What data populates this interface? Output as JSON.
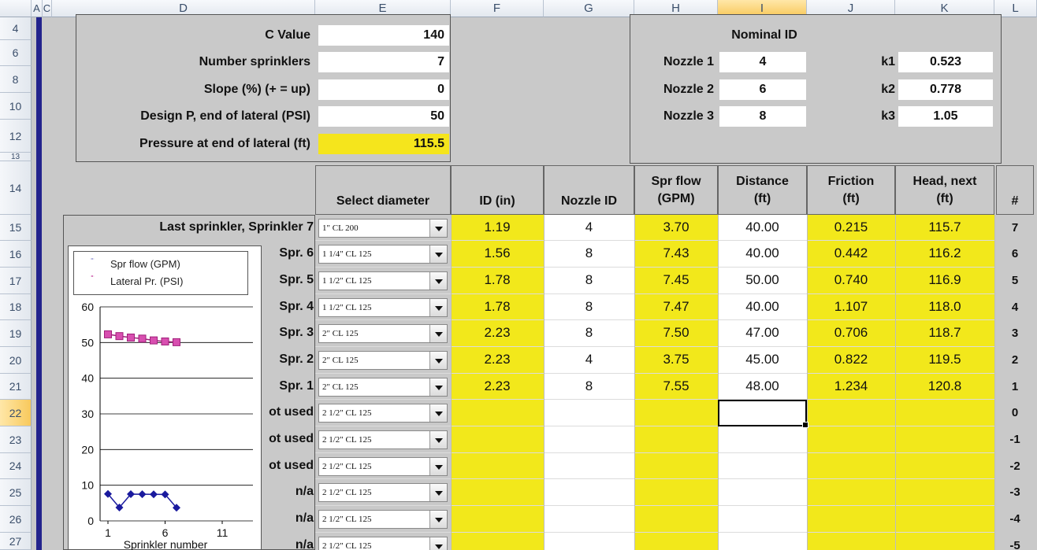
{
  "columns": [
    "A",
    "C",
    "D",
    "E",
    "F",
    "G",
    "H",
    "I",
    "J",
    "K",
    "L"
  ],
  "rows": [
    "4",
    "6",
    "8",
    "10",
    "12",
    "13",
    "14",
    "15",
    "16",
    "17",
    "18",
    "19",
    "20",
    "21",
    "22",
    "23",
    "24",
    "25",
    "26",
    "27"
  ],
  "inputs": {
    "c_value": {
      "label": "C Value",
      "value": "140"
    },
    "num_sprinklers": {
      "label": "Number sprinklers",
      "value": "7"
    },
    "slope": {
      "label": "Slope (%) (+ = up)",
      "value": "0"
    },
    "design_p": {
      "label": "Design P, end of lateral (PSI)",
      "value": "50"
    },
    "pressure_end": {
      "label": "Pressure at end of lateral (ft)",
      "value": "115.5"
    }
  },
  "nozzles": {
    "header": "Nominal ID",
    "items": [
      {
        "label": "Nozzle 1",
        "id": "4",
        "klabel": "k1",
        "k": "0.523"
      },
      {
        "label": "Nozzle 2",
        "id": "6",
        "klabel": "k2",
        "k": "0.778"
      },
      {
        "label": "Nozzle 3",
        "id": "8",
        "klabel": "k3",
        "k": "1.05"
      }
    ]
  },
  "table": {
    "headers": {
      "select": "Select diameter",
      "id": "ID (in)",
      "nozzle": "Nozzle ID",
      "spr1": "Spr flow",
      "spr2": "(GPM)",
      "dist1": "Distance",
      "dist2": "(ft)",
      "fric1": "Friction",
      "fric2": "(ft)",
      "head1": "Head, next",
      "head2": "(ft)",
      "num": "#"
    },
    "last_label": "Last sprinkler, Sprinkler 7",
    "rows": [
      {
        "label": "",
        "pipe": "1\" CL 200",
        "id": "1.19",
        "nozzle": "4",
        "flow": "3.70",
        "dist": "40.00",
        "fric": "0.215",
        "head": "115.7",
        "num": "7"
      },
      {
        "label": "Spr. 6",
        "pipe": "1 1/4\" CL 125",
        "id": "1.56",
        "nozzle": "8",
        "flow": "7.43",
        "dist": "40.00",
        "fric": "0.442",
        "head": "116.2",
        "num": "6"
      },
      {
        "label": "Spr. 5",
        "pipe": "1 1/2\" CL 125",
        "id": "1.78",
        "nozzle": "8",
        "flow": "7.45",
        "dist": "50.00",
        "fric": "0.740",
        "head": "116.9",
        "num": "5"
      },
      {
        "label": "Spr. 4",
        "pipe": "1 1/2\" CL 125",
        "id": "1.78",
        "nozzle": "8",
        "flow": "7.47",
        "dist": "40.00",
        "fric": "1.107",
        "head": "118.0",
        "num": "4"
      },
      {
        "label": "Spr. 3",
        "pipe": "2\" CL 125",
        "id": "2.23",
        "nozzle": "8",
        "flow": "7.50",
        "dist": "47.00",
        "fric": "0.706",
        "head": "118.7",
        "num": "3"
      },
      {
        "label": "Spr. 2",
        "pipe": "2\" CL 125",
        "id": "2.23",
        "nozzle": "4",
        "flow": "3.75",
        "dist": "45.00",
        "fric": "0.822",
        "head": "119.5",
        "num": "2"
      },
      {
        "label": "Spr. 1",
        "pipe": "2\" CL 125",
        "id": "2.23",
        "nozzle": "8",
        "flow": "7.55",
        "dist": "48.00",
        "fric": "1.234",
        "head": "120.8",
        "num": "1"
      },
      {
        "label": "ot used",
        "pipe": "2 1/2\" CL 125",
        "id": "",
        "nozzle": "",
        "flow": "",
        "dist": "",
        "fric": "",
        "head": "",
        "num": "0"
      },
      {
        "label": "ot used",
        "pipe": "2 1/2\" CL 125",
        "id": "",
        "nozzle": "",
        "flow": "",
        "dist": "",
        "fric": "",
        "head": "",
        "num": "-1"
      },
      {
        "label": "ot used",
        "pipe": "2 1/2\" CL 125",
        "id": "",
        "nozzle": "",
        "flow": "",
        "dist": "",
        "fric": "",
        "head": "",
        "num": "-2"
      },
      {
        "label": "n/a",
        "pipe": "2 1/2\" CL 125",
        "id": "",
        "nozzle": "",
        "flow": "",
        "dist": "",
        "fric": "",
        "head": "",
        "num": "-3"
      },
      {
        "label": "n/a",
        "pipe": "2 1/2\" CL 125",
        "id": "",
        "nozzle": "",
        "flow": "",
        "dist": "",
        "fric": "",
        "head": "",
        "num": "-4"
      },
      {
        "label": "n/a",
        "pipe": "2 1/2\" CL 125",
        "id": "",
        "nozzle": "",
        "flow": "",
        "dist": "",
        "fric": "",
        "head": "",
        "num": "-5"
      }
    ]
  },
  "chart_data": {
    "type": "line",
    "xlabel": "Sprinkler number",
    "x_ticks": [
      "1",
      "6",
      "11"
    ],
    "y_ticks": [
      "0",
      "10",
      "20",
      "30",
      "40",
      "50",
      "60"
    ],
    "ylim": [
      0,
      60
    ],
    "xlim": [
      1,
      13
    ],
    "series": [
      {
        "name": "Spr flow (GPM)",
        "color": "#1a1a9e",
        "marker": "diamond",
        "x": [
          1,
          2,
          3,
          4,
          5,
          6,
          7
        ],
        "values": [
          7.55,
          3.75,
          7.5,
          7.47,
          7.45,
          7.43,
          3.7
        ]
      },
      {
        "name": "Lateral Pr. (PSI)",
        "color": "#a0207a",
        "marker": "square",
        "x": [
          1,
          2,
          3,
          4,
          5,
          6,
          7
        ],
        "values": [
          52.3,
          51.8,
          51.4,
          51.1,
          50.6,
          50.3,
          50.1
        ]
      }
    ],
    "grid": true,
    "legend": "top"
  },
  "colors": {
    "highlight": "#f2e81b",
    "sheet_bg": "#c9c9c9",
    "selection": "#f8c95c"
  }
}
